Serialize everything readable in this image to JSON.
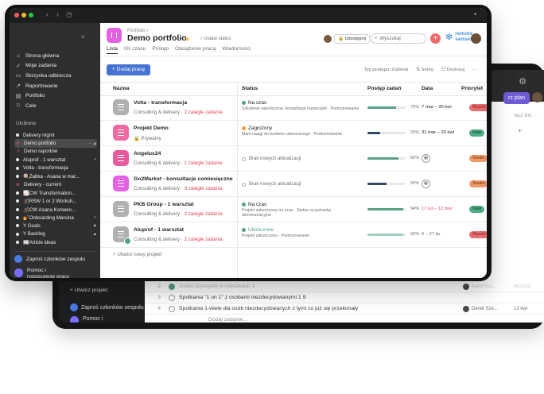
{
  "back": {
    "plan_button": "rz plan",
    "link_text": "łącz link",
    "add_project": "+ Utwórz projekt",
    "invite": "Zaproś członków zespołu",
    "help": "Pomoc i rozpoczęcie pracy",
    "rows": [
      {
        "num": "2",
        "task": "Zrobić porządek w mieszkach  1",
        "assignee": "Karol Sza...",
        "due": "Wczoraj",
        "faded": true
      },
      {
        "num": "3",
        "task": "Spotkania \"1 on 1\" z osobami niezdecydowanymi  1  9",
        "assignee": "",
        "due": "",
        "faded": false
      },
      {
        "num": "4",
        "task": "Spotkania 1-wiele dla osób niezdecydowanych z tymi co już się przekonały",
        "assignee": "Derek Sze...",
        "due": "12 kwi",
        "faded": false
      },
      {
        "num": "",
        "task": "Dodaj zadanie...",
        "assignee": "",
        "due": "",
        "faded": false
      }
    ]
  },
  "sidebar": {
    "nav": [
      {
        "icon": "home-icon",
        "glyph": "⌂",
        "label": "Strona główna"
      },
      {
        "icon": "check-circle-icon",
        "glyph": "✓",
        "label": "Moje zadania"
      },
      {
        "icon": "inbox-icon",
        "glyph": "▭",
        "label": "Skrzynka odbiorcza"
      },
      {
        "icon": "trend-icon",
        "glyph": "↗",
        "label": "Raportowanie"
      },
      {
        "icon": "portfolio-icon",
        "glyph": "▤",
        "label": "Portfolio"
      },
      {
        "icon": "goal-icon",
        "glyph": "⚐",
        "label": "Cele"
      }
    ],
    "section_title": "Ulubione",
    "projects": [
      {
        "label": "Delivery mgmt",
        "tail": "",
        "prefix": "",
        "active": false
      },
      {
        "label": "Demo portfolio",
        "tail": "··· ▲",
        "prefix": "ılı",
        "active": true
      },
      {
        "label": "Demo raportów",
        "tail": "",
        "prefix": "↗",
        "active": false
      },
      {
        "label": "Aluprof - 1 warsztat",
        "tail": "✓",
        "prefix": "",
        "active": false
      },
      {
        "label": "Volta - transformacja",
        "tail": "",
        "prefix": "",
        "active": false
      },
      {
        "label": "🍭Żabka - Asana w mar...",
        "tail": "",
        "prefix": "",
        "active": false
      },
      {
        "label": "Delivery - current",
        "tail": "",
        "prefix": "ılı",
        "active": false
      },
      {
        "label": "📈CW Transformation...",
        "tail": "",
        "prefix": "",
        "active": false
      },
      {
        "label": "🎢RSW 1 or 2 Worksh...",
        "tail": "",
        "prefix": "",
        "active": false
      },
      {
        "label": "🎢CW Asana Konwen...",
        "tail": "",
        "prefix": "",
        "active": false
      },
      {
        "label": "💅Onboarding Marcina",
        "tail": "✓",
        "prefix": "",
        "active": false
      },
      {
        "label": "Y Goals",
        "tail": "▲",
        "prefix": "",
        "active": false
      },
      {
        "label": "Y Backlog",
        "tail": "▲",
        "prefix": "",
        "active": false
      },
      {
        "label": "📰Article ideas",
        "tail": "",
        "prefix": "",
        "active": false
      }
    ],
    "invite": "Zaproś członków zespołu",
    "help": "Pomoc i rozpoczęcie pracy"
  },
  "header": {
    "breadcrumb": "Portfolio ›",
    "title": "Demo portfolio",
    "set_status": "○ Ustaw status",
    "share": "🔒 Udostępnij",
    "search_placeholder": "Wyszukaj",
    "logo_line1": "remote",
    "logo_line2": "sensei"
  },
  "tabs": [
    "Lista",
    "Oś czasu",
    "Postęp",
    "Obciążenie pracą",
    "Wiadomości"
  ],
  "toolbar": {
    "add_work": "+ Dodaj pracę",
    "progress_type": "Typ postępu: Zadania",
    "sort": "⇅ Sortuj",
    "customize": "☷ Dostosuj",
    "more": "···"
  },
  "columns": {
    "name": "Nazwa",
    "status": "Status",
    "progress": "Postęp zadań",
    "date": "Data",
    "priority": "Priorytet"
  },
  "rows": [
    {
      "name": "Volta - transformacja",
      "sub": "Consulting & delivery · ",
      "late": "2 zaległe zadania",
      "icon_color": "#b0b0b0",
      "badge": false,
      "status": "Na czas",
      "status_color": "#58a182",
      "desc": "Szkolenie zakończone, konsultacje rozpoczęte · Podsumowanie",
      "progress": 76,
      "pct": "76%",
      "bar": "normal",
      "date": "7 mar – 30 kwi",
      "date_style": "normal",
      "priority": "Wysoki",
      "prio_class": "prio-high"
    },
    {
      "name": "Projekt Demo",
      "sub": "🔒 Prywatny",
      "late": "",
      "icon_color": "#f06aa4",
      "badge": false,
      "status": "Zagrożony",
      "status_color": "#f1a03b",
      "desc": "Mam uwagi do budżetu całorocznego · Podsumowanie",
      "progress": 33,
      "pct": "33%",
      "bar": "dark",
      "date": "31 mar – 26 kwi",
      "date_style": "normal",
      "priority": "Niski",
      "prio_class": "prio-low"
    },
    {
      "name": "Angelus24",
      "sub": "Consulting & delivery · ",
      "late": "1 zaległe zadanie",
      "icon_color": "#e85a9c",
      "badge": false,
      "status": "",
      "status_color": "",
      "desc": "Brak nowych aktualizacji",
      "progress": 82,
      "pct": "82%",
      "bar": "normal",
      "date": "",
      "date_style": "cal",
      "priority": "Średni",
      "prio_class": "prio-mid"
    },
    {
      "name": "Go2Market - konsultacje comiesięczne",
      "sub": "Consulting & delivery · ",
      "late": "3 zaległe zadania",
      "icon_color": "#e362e3",
      "badge": false,
      "status": "",
      "status_color": "",
      "desc": "Brak nowych aktualizacji",
      "progress": 50,
      "pct": "50%",
      "bar": "dark",
      "date": "",
      "date_style": "cal",
      "priority": "Średni",
      "prio_class": "prio-mid"
    },
    {
      "name": "PKB Group - 1 warsztat",
      "sub": "Consulting & delivery · ",
      "late": "2 zaległe zadania",
      "icon_color": "#b0b0b0",
      "badge": false,
      "status": "Na czas",
      "status_color": "#58a182",
      "desc": "Projekt zakończony na czas · Status na potrzeby demonstracyjne",
      "progress": 94,
      "pct": "94%",
      "bar": "normal",
      "date": "17 lut – 12 mar",
      "date_style": "late",
      "priority": "Niski",
      "prio_class": "prio-low"
    },
    {
      "name": "Aluprof - 1 warsztat",
      "sub": "Consulting & delivery · ",
      "late": "2 zaległe zadania",
      "icon_color": "#b0b0b0",
      "badge": true,
      "status": "Ukończone",
      "status_color": "#58a182",
      "desc": "Projekt zakończony · Podsumowanie",
      "progress": 93,
      "pct": "93%",
      "bar": "light",
      "date": "6 – 27 lip",
      "date_style": "faded",
      "priority": "Wysoki",
      "prio_class": "prio-high"
    }
  ],
  "new_project": "+ Utwórz nowy projekt"
}
